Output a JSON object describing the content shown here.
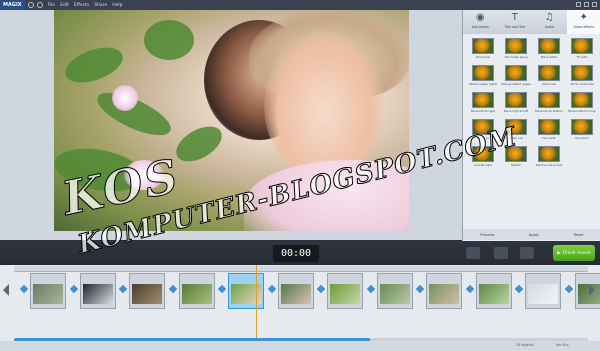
{
  "app": {
    "brand": "MAGIX",
    "menu": [
      "File",
      "Edit",
      "Effects",
      "Share",
      "Help"
    ]
  },
  "watermark": {
    "line1": "KOS",
    "line2": "KOMPUTER-BLOGSPOT.COM"
  },
  "right_panel": {
    "tabs": [
      {
        "label": "Add object",
        "icon": "circle"
      },
      {
        "label": "Title and Text",
        "icon": "T"
      },
      {
        "label": "Audio",
        "icon": "waveform"
      },
      {
        "label": "Video effects",
        "icon": "sparkle"
      }
    ],
    "active_tab": 3,
    "effects": [
      "Old movie",
      "Old image aging",
      "Black white",
      "TV retro",
      "Sketch edges (light)",
      "Moving sketch edges",
      "Add noise",
      "Mirror horizontal",
      "Move left to right",
      "Move right to left",
      "Move top to bottom",
      "Move bottom to top",
      "Zoom in",
      "Zoom out",
      "Fine solar",
      "Use zoom",
      "Overlay light",
      "Stretch",
      "Remove black bars"
    ],
    "footer": [
      "Preview",
      "Apply",
      "Reset"
    ]
  },
  "transport": {
    "timecode": "00:00",
    "make_movie_label": "Finish movie"
  },
  "storyboard": {
    "clips": [
      {
        "colors": [
          "#6e7b64",
          "#a7b89a"
        ]
      },
      {
        "colors": [
          "#20262c",
          "#d9dde0"
        ]
      },
      {
        "colors": [
          "#4d3f2f",
          "#9e8d6c"
        ]
      },
      {
        "colors": [
          "#5b7c3d",
          "#a7c07b"
        ]
      },
      {
        "colors": [
          "#6aa34a",
          "#e9d4c0"
        ]
      },
      {
        "colors": [
          "#55784a",
          "#d4c2b5"
        ]
      },
      {
        "colors": [
          "#6c9a3c",
          "#c9d8a5"
        ]
      },
      {
        "colors": [
          "#698c54",
          "#bac9a7"
        ]
      },
      {
        "colors": [
          "#7a8f5f",
          "#cdbfa8"
        ]
      },
      {
        "colors": [
          "#5e8844",
          "#bcd3a3"
        ]
      },
      {
        "colors": [
          "#d6dbdf",
          "#f2f4f6"
        ]
      },
      {
        "colors": [
          "#4b6c3b",
          "#9eb78c"
        ]
      }
    ],
    "selected_clip": 4
  },
  "status": {
    "objects": "10 objects",
    "duration": "0m:41s"
  },
  "colors": {
    "accent": "#3d8fd6",
    "make_movie": "#5cb82a",
    "selected_clip": "#9fd1f3"
  }
}
